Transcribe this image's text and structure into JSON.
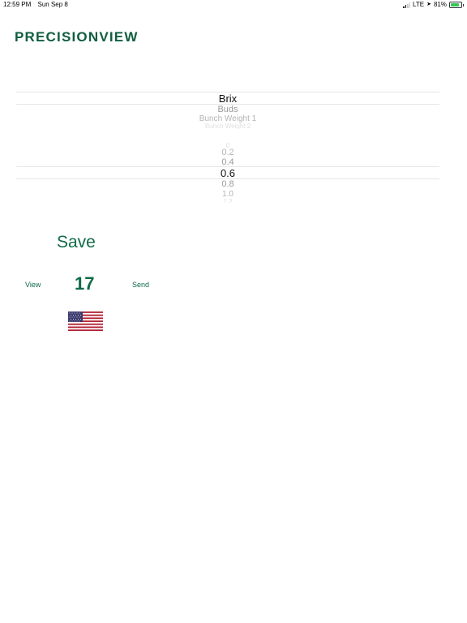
{
  "status_bar": {
    "time": "12:59 PM",
    "date": "Sun Sep 8",
    "network": "LTE",
    "battery_percent": "81%",
    "battery_level": 0.81,
    "icons": [
      "signal-icon",
      "location-icon",
      "battery-icon"
    ]
  },
  "logo": {
    "text": "PRECISIONVIEW"
  },
  "category_picker": {
    "selected": "Brix",
    "below": [
      "Buds",
      "Bunch Weight 1",
      "Bunch Weight 2"
    ]
  },
  "value_picker": {
    "above": [
      "0",
      "0.2",
      "0.4"
    ],
    "selected": "0.6",
    "below": [
      "0.8",
      "1.0",
      "1.2"
    ]
  },
  "actions": {
    "save_label": "Save",
    "view_label": "View",
    "send_label": "Send",
    "count": "17"
  },
  "language": {
    "flag_icon": "us-flag-icon"
  },
  "colors": {
    "accent": "#0f6b47",
    "logo": "#0f5e3e",
    "battery": "#34c759"
  }
}
